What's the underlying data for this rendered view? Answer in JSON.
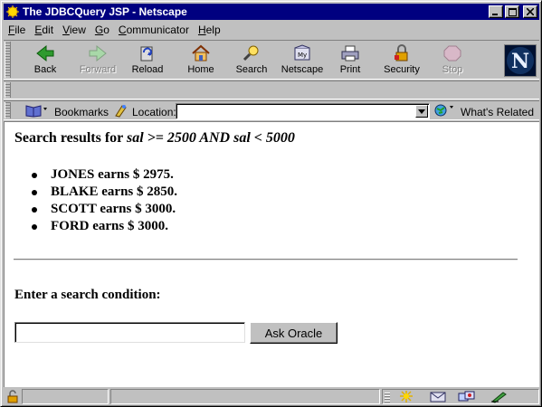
{
  "window": {
    "title": "The JDBCQuery JSP - Netscape",
    "controls": [
      "minimize",
      "maximize",
      "close"
    ]
  },
  "menu": [
    {
      "label": "File",
      "key": "F",
      "rest": "ile"
    },
    {
      "label": "Edit",
      "key": "E",
      "rest": "dit"
    },
    {
      "label": "View",
      "key": "V",
      "rest": "iew"
    },
    {
      "label": "Go",
      "key": "G",
      "rest": "o"
    },
    {
      "label": "Communicator",
      "key": "C",
      "rest": "ommunicator"
    },
    {
      "label": "Help",
      "key": "H",
      "rest": "elp"
    }
  ],
  "toolbar": {
    "buttons": [
      {
        "label": "Back",
        "icon": "back-arrow-icon",
        "enabled": true
      },
      {
        "label": "Forward",
        "icon": "forward-arrow-icon",
        "enabled": false
      },
      {
        "label": "Reload",
        "icon": "reload-icon",
        "enabled": true
      },
      {
        "label": "Home",
        "icon": "home-icon",
        "enabled": true
      },
      {
        "label": "Search",
        "icon": "search-icon",
        "enabled": true
      },
      {
        "label": "Netscape",
        "icon": "my-netscape-icon",
        "enabled": true
      },
      {
        "label": "Print",
        "icon": "print-icon",
        "enabled": true
      },
      {
        "label": "Security",
        "icon": "security-lock-icon",
        "enabled": true
      },
      {
        "label": "Stop",
        "icon": "stop-icon",
        "enabled": false
      }
    ]
  },
  "location_bar": {
    "bookmarks_label": "Bookmarks",
    "location_label": "Location:",
    "url": "",
    "whats_related_label": "What's Related"
  },
  "page": {
    "heading_prefix": "Search results for",
    "heading_condition": "sal >= 2500 AND sal < 5000",
    "results": [
      "JONES earns $ 2975.",
      "BLAKE earns $ 2850.",
      "SCOTT earns $ 3000.",
      "FORD earns $ 3000."
    ],
    "prompt": "Enter a search condition:",
    "search_value": "",
    "ask_button_label": "Ask Oracle"
  },
  "colors": {
    "titlebar": "#000080",
    "chrome": "#c0c0c0",
    "content_bg": "#ffffff"
  }
}
